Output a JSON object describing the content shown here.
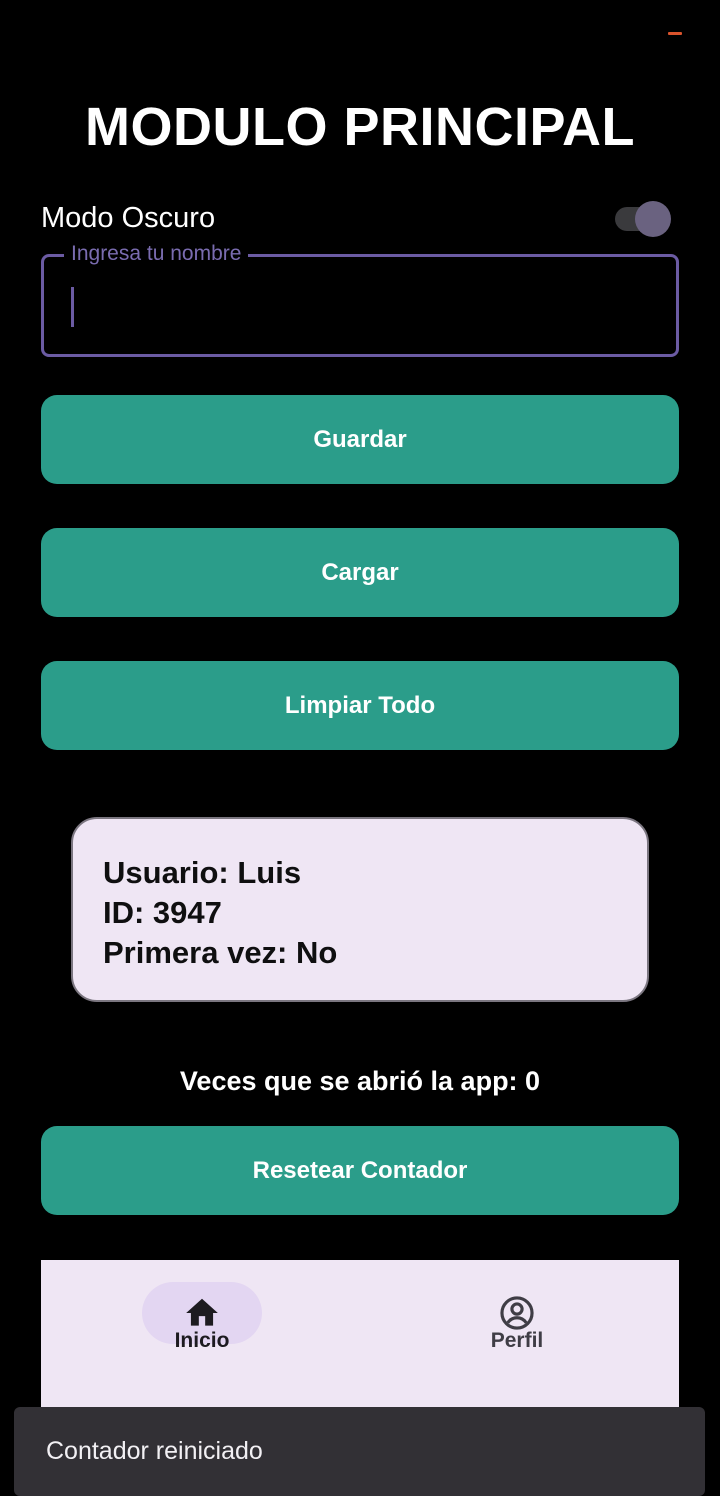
{
  "header": {
    "title": "MODULO PRINCIPAL"
  },
  "settings": {
    "dark_mode_label": "Modo Oscuro",
    "dark_mode_on": true
  },
  "name_field": {
    "label": "Ingresa tu nombre",
    "value": ""
  },
  "buttons": {
    "save_label": "Guardar",
    "load_label": "Cargar",
    "clear_label": "Limpiar Todo",
    "reset_label": "Resetear Contador"
  },
  "info_card": {
    "user_line": "Usuario: Luis",
    "id_line": "ID: 3947",
    "first_time_line": "Primera vez: No"
  },
  "counter": {
    "text": "Veces que se abrió la app: 0"
  },
  "nav": {
    "items": [
      {
        "label": "Inicio",
        "icon": "home-icon",
        "selected": true
      },
      {
        "label": "Perfil",
        "icon": "account-circle-icon",
        "selected": false
      }
    ]
  },
  "snackbar": {
    "message": "Contador reiniciado"
  },
  "colors": {
    "accent_button": "#2b9d8a",
    "outline": "#6b5ba3",
    "card_background": "#efe6f4",
    "status_indicator": "#d9532c"
  }
}
